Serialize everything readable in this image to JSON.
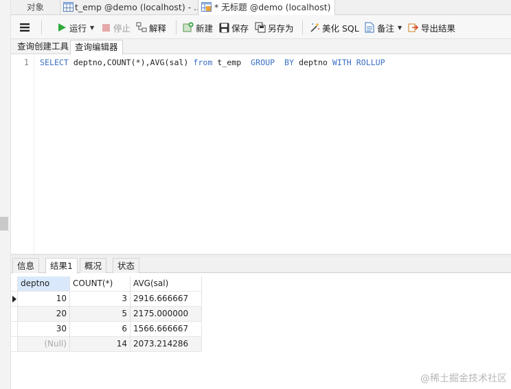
{
  "tabs": {
    "objects": "对象",
    "table_tab": "t_emp @demo (localhost) - ...",
    "query_tab": "* 无标题 @demo (localhost) ..."
  },
  "toolbar": {
    "run": "运行",
    "stop": "停止",
    "explain": "解释",
    "new": "新建",
    "save": "保存",
    "save_as": "另存为",
    "beautify": "美化 SQL",
    "comment": "备注",
    "export": "导出结果"
  },
  "subtabs": {
    "builder": "查询创建工具",
    "editor": "查询编辑器"
  },
  "editor": {
    "line_number": "1",
    "tokens": [
      {
        "text": "SELECT ",
        "kw": true
      },
      {
        "text": "deptno,COUNT(*),AVG(sal) ",
        "kw": false
      },
      {
        "text": "from ",
        "kw": true
      },
      {
        "text": "t_emp  ",
        "kw": false
      },
      {
        "text": "GROUP  BY ",
        "kw": true
      },
      {
        "text": "deptno ",
        "kw": false
      },
      {
        "text": "WITH ROLLUP",
        "kw": true
      }
    ]
  },
  "result_tabs": {
    "info": "信息",
    "result1": "结果1",
    "profile": "概况",
    "status": "状态"
  },
  "results": {
    "columns": [
      "deptno",
      "COUNT(*)",
      "AVG(sal)"
    ],
    "rows": [
      {
        "deptno": "10",
        "count": "3",
        "avg": "2916.666667"
      },
      {
        "deptno": "20",
        "count": "5",
        "avg": "2175.000000"
      },
      {
        "deptno": "30",
        "count": "6",
        "avg": "1566.666667"
      },
      {
        "deptno": "(Null)",
        "count": "14",
        "avg": "2073.214286"
      }
    ]
  },
  "watermark": "@稀土掘金技术社区"
}
